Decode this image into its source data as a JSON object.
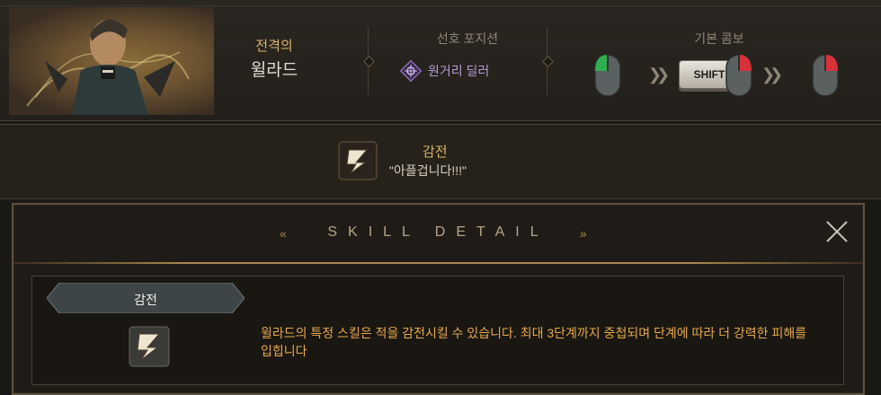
{
  "character": {
    "class_line1": "전격의",
    "class_line2": "윌라드",
    "portrait_icon": "character-portrait"
  },
  "position": {
    "label": "선호 포지션",
    "value": "원거리 딜러",
    "icon": "crosshair-diamond-icon"
  },
  "combo": {
    "label": "기본 콤보",
    "shift_key": "SHIFT",
    "steps": [
      "left-click",
      "shift + right-click",
      "right-click"
    ]
  },
  "skill_summary": {
    "name": "감전",
    "quote": "\"아플겁니다!!!\"",
    "icon": "lightning-skill-icon"
  },
  "skill_detail": {
    "title": "SKILL DETAIL",
    "name": "감전",
    "description": "윌라드의 특정 스킬은 적을 감전시킬 수 있습니다. 최대 3단계까지 중첩되며 단계에 따라 더 강력한 피해를 입힙니다"
  },
  "colors": {
    "gold": "#d9b56c",
    "accent_orange": "#e7a94a",
    "position_purple": "#b79ad8"
  }
}
